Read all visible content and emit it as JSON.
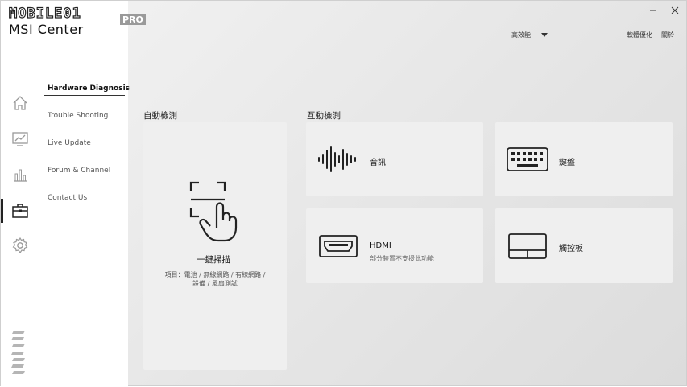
{
  "app": {
    "logo_top": "MOBILE01",
    "logo_pro": "PRO",
    "title": "MSI Center"
  },
  "topbar": {
    "mode_label": "高效能",
    "optimize_label": "軟體優化",
    "about_label": "關於"
  },
  "nav": {
    "items": [
      {
        "label": "Hardware Diagnosis"
      },
      {
        "label": "Trouble Shooting"
      },
      {
        "label": "Live Update"
      },
      {
        "label": "Forum & Channel"
      },
      {
        "label": "Contact Us"
      }
    ]
  },
  "sections": {
    "auto_label": "自動檢測",
    "interactive_label": "互動檢測"
  },
  "scan_card": {
    "title": "一鍵掃描",
    "desc_line1": "項目：電池 / 無線網路 / 有線網路 /",
    "desc_line2": "設備 / 風扇測試"
  },
  "cards": {
    "audio": {
      "title": "音訊"
    },
    "keyboard": {
      "title": "鍵盤"
    },
    "hdmi": {
      "title": "HDMI",
      "subtitle": "部分裝置不支援此功能"
    },
    "touchpad": {
      "title": "觸控板"
    }
  },
  "icons": {
    "sidebar": [
      "home-icon",
      "performance-icon",
      "stats-icon",
      "toolbox-icon",
      "settings-icon"
    ],
    "window": [
      "minimize-icon",
      "close-icon"
    ]
  }
}
